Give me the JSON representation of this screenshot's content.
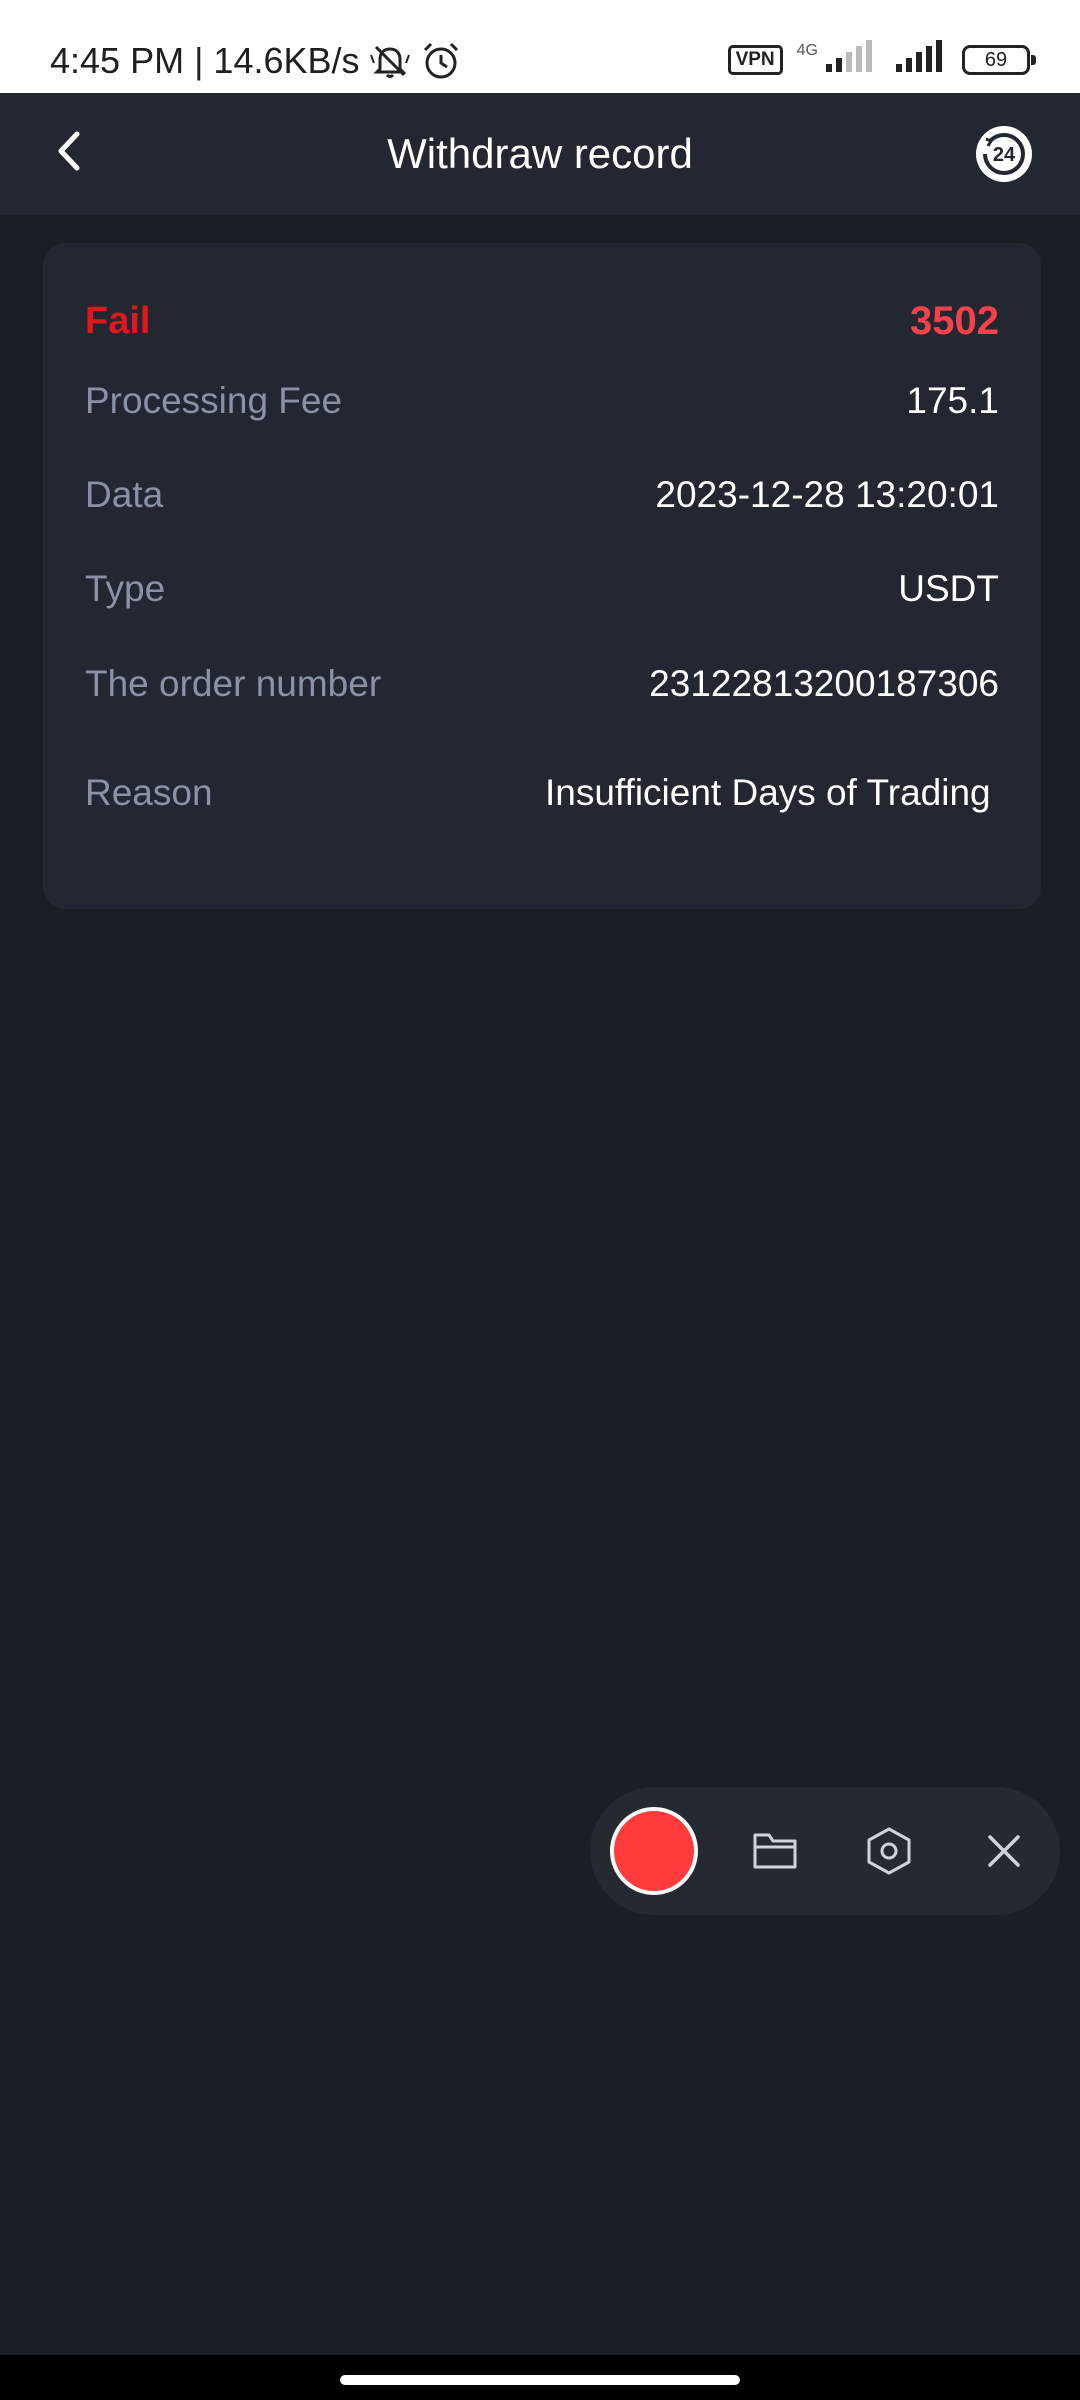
{
  "status_bar": {
    "time_speed": "4:45 PM | 14.6KB/s",
    "vpn_label": "VPN",
    "network_type": "4G",
    "battery_level": "69",
    "icons": [
      "mute-bell-icon",
      "alarm-clock-icon",
      "signal-icon",
      "battery-icon"
    ]
  },
  "header": {
    "title": "Withdraw record",
    "back_icon": "chevron-left-icon",
    "support_icon": "support-24h-icon",
    "support_label": "24"
  },
  "record": {
    "status_label": "Fail",
    "amount": "3502",
    "rows": [
      {
        "label": "Processing Fee",
        "value": "175.1"
      },
      {
        "label": "Data",
        "value": "2023-12-28 13:20:01"
      },
      {
        "label": "Type",
        "value": "USDT"
      },
      {
        "label": "The order number",
        "value": "23122813200187306"
      },
      {
        "label": "Reason",
        "value": "Insufficient Days of Trading"
      }
    ]
  },
  "recorder_toolbar": {
    "icons": [
      "record-button",
      "folder-icon",
      "settings-hexagon-icon",
      "close-icon"
    ]
  },
  "colors": {
    "background": "#1a1e25",
    "card": "#222731",
    "fail_red": "#e0171d",
    "amount_red": "#f5424a",
    "label_gray": "#8a92a6"
  }
}
